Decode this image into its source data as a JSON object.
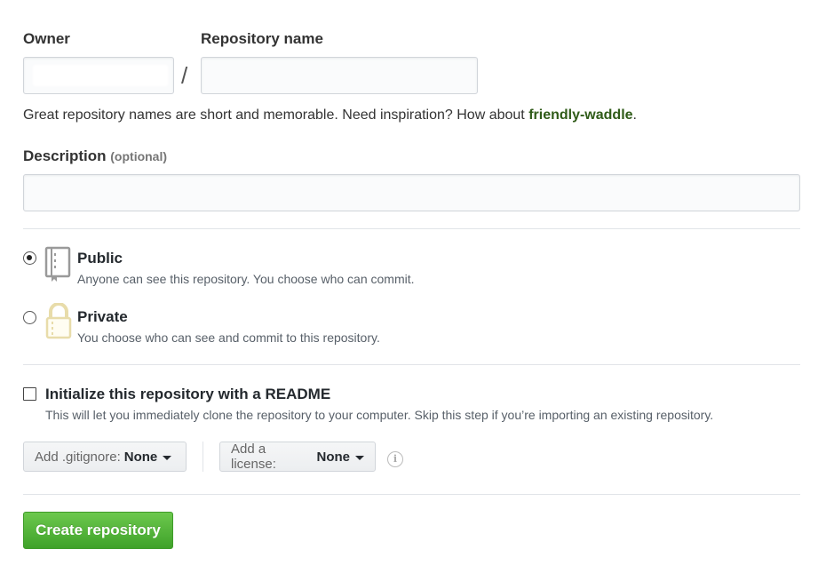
{
  "owner": {
    "label": "Owner",
    "value": ""
  },
  "separator": "/",
  "repo_name": {
    "label": "Repository name",
    "value": "",
    "placeholder": ""
  },
  "helper": {
    "text": "Great repository names are short and memorable. Need inspiration? How about ",
    "suggestion": "friendly-waddle",
    "end": "."
  },
  "description": {
    "label": "Description",
    "optional": "(optional)",
    "value": ""
  },
  "visibility": {
    "public": {
      "title": "Public",
      "desc": "Anyone can see this repository. You choose who can commit.",
      "checked": true,
      "icon": "repo-book-icon"
    },
    "private": {
      "title": "Private",
      "desc": "You choose who can see and commit to this repository.",
      "checked": false,
      "icon": "lock-icon"
    }
  },
  "readme": {
    "label": "Initialize this repository with a README",
    "desc": "This will let you immediately clone the repository to your computer. Skip this step if you’re importing an existing repository.",
    "checked": false
  },
  "gitignore": {
    "label": "Add .gitignore:",
    "value": "None"
  },
  "license": {
    "label": "Add a license:",
    "value": "None"
  },
  "submit": {
    "label": "Create repository"
  },
  "colors": {
    "accent_green": "#3fa22a",
    "suggestion": "#2f5b18",
    "lock_icon": "#e8dcaa"
  }
}
